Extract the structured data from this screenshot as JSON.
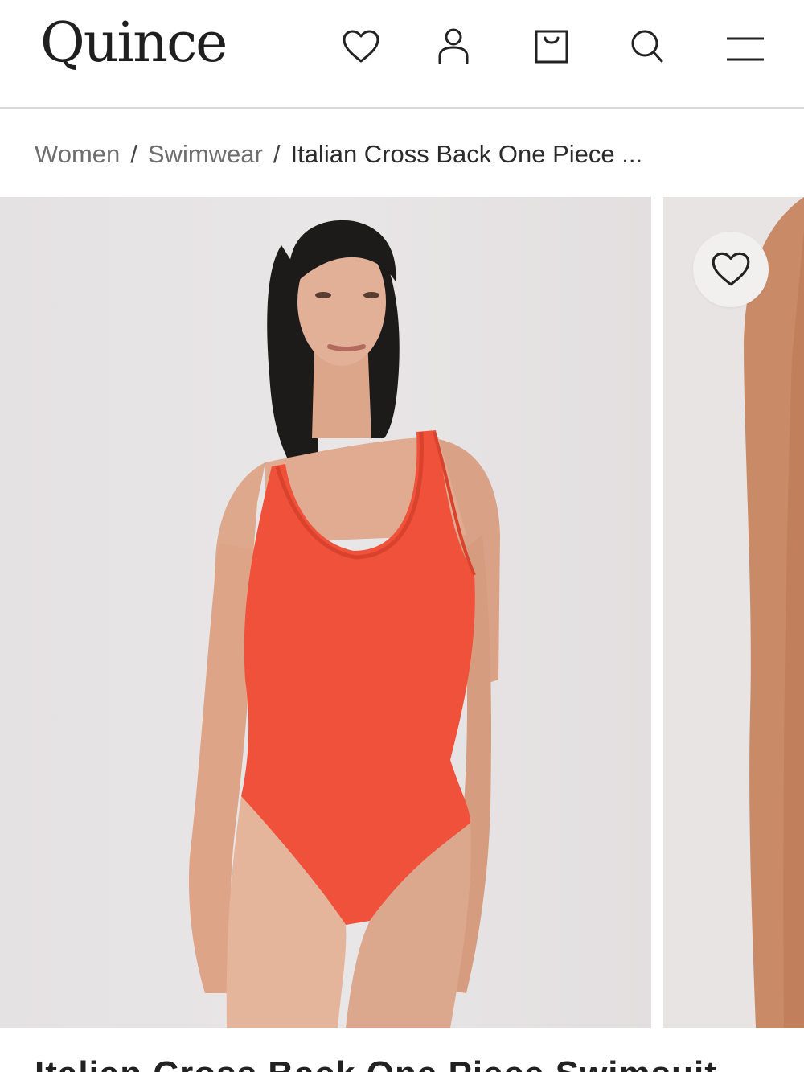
{
  "brand": {
    "logo_text": "Quince"
  },
  "header": {
    "icons": [
      "heart-icon",
      "user-icon",
      "shopping-bag-icon",
      "search-icon",
      "menu-icon"
    ]
  },
  "breadcrumb": {
    "items": [
      {
        "label": "Women"
      },
      {
        "label": "Swimwear"
      }
    ],
    "separator": "/",
    "current": "Italian Cross Back One Piece ..."
  },
  "product": {
    "title": "Italian Cross Back One Piece Swimsuit",
    "color_swatch": "#f0513a"
  },
  "gallery": {
    "wishlist_icon": "heart-icon"
  }
}
